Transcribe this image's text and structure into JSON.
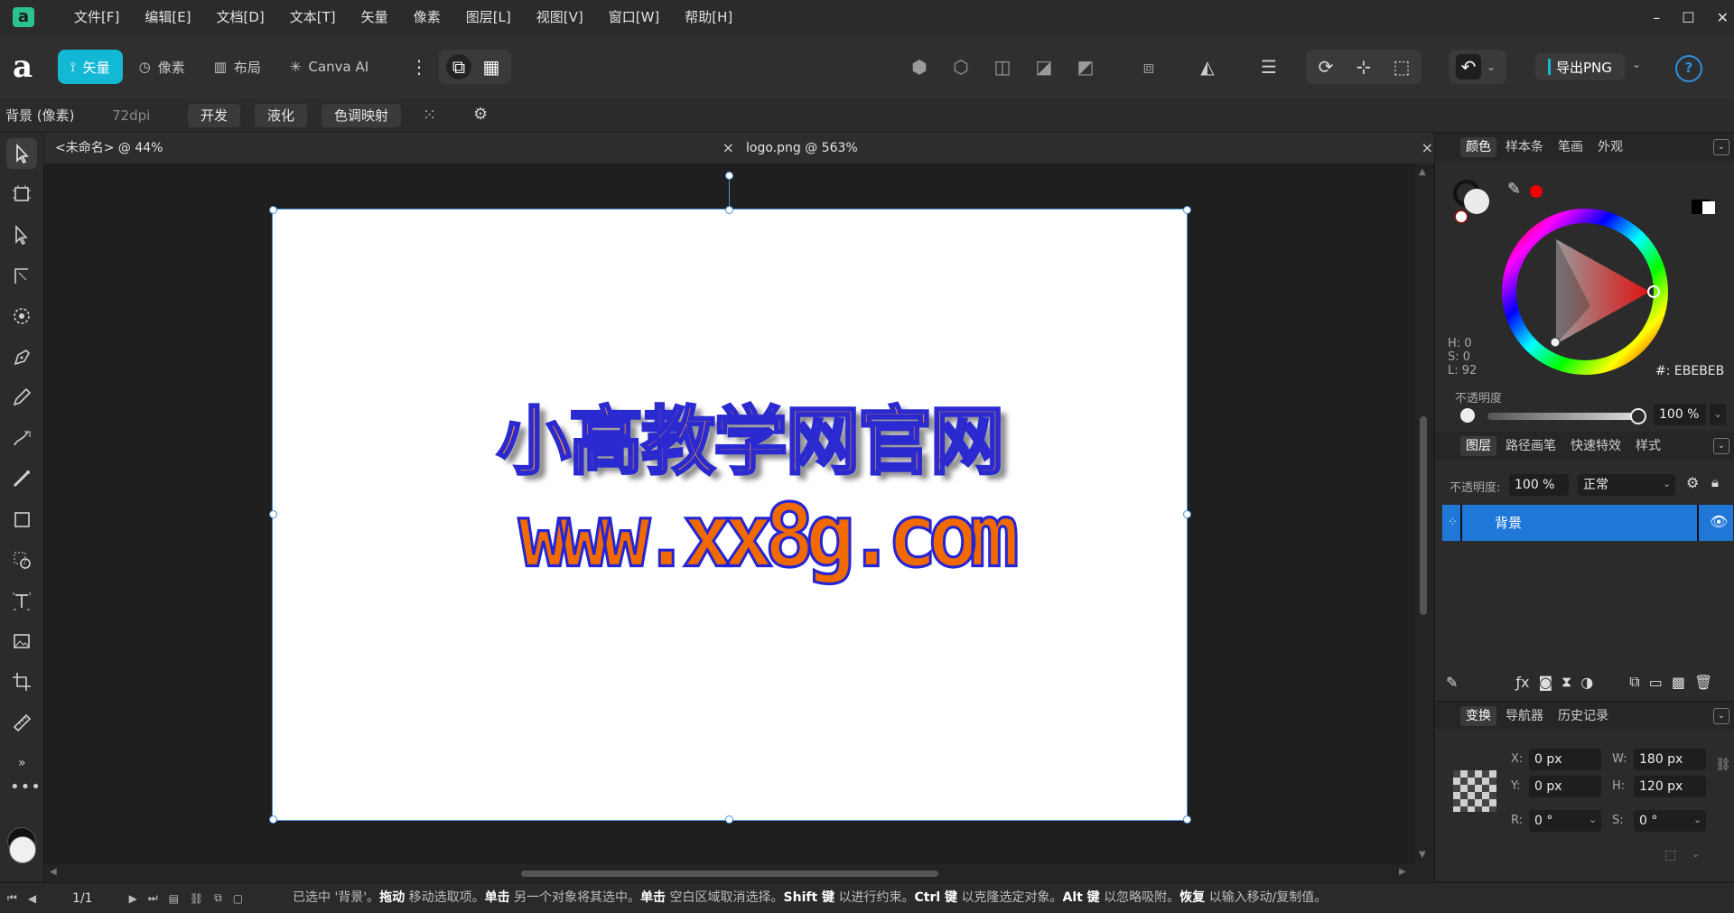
{
  "menubar": {
    "items": [
      "文件[F]",
      "编辑[E]",
      "文档[D]",
      "文本[T]",
      "矢量",
      "像素",
      "图层[L]",
      "视图[V]",
      "窗口[W]",
      "帮助[H]"
    ],
    "window_controls": [
      "–",
      "☐",
      "✕"
    ]
  },
  "toolbar": {
    "personas": [
      {
        "label": "矢量",
        "active": true
      },
      {
        "label": "像素",
        "active": false
      },
      {
        "label": "布局",
        "active": false
      },
      {
        "label": "Canva AI",
        "active": false
      }
    ],
    "export_label": "导出PNG",
    "help_label": "?"
  },
  "context": {
    "layer_label": "背景 (像素)",
    "dpi": "72dpi",
    "buttons": [
      "开发",
      "液化",
      "色调映射"
    ]
  },
  "documents": {
    "tabs": [
      {
        "title": "<未命名> @ 44%"
      },
      {
        "title": "logo.png @ 563%"
      }
    ],
    "close_glyph": "×",
    "canvas_text": {
      "line1": "小高教学网官网",
      "line2": "www.xx8g.com"
    }
  },
  "color_panel": {
    "tabs": [
      "颜色",
      "样本条",
      "笔画",
      "外观"
    ],
    "h": "H: 0",
    "s": "S: 0",
    "l": "L: 92",
    "hex": "#: EBEBEB",
    "opacity_label": "不透明度",
    "opacity_value": "100 %"
  },
  "layers_panel": {
    "tabs": [
      "图层",
      "路径画笔",
      "快速特效",
      "样式"
    ],
    "opacity_label": "不透明度:",
    "opacity_value": "100 %",
    "blend_mode": "正常",
    "layers": [
      {
        "name": "背景"
      }
    ]
  },
  "transform_panel": {
    "tabs": [
      "变换",
      "导航器",
      "历史记录"
    ],
    "x": "0 px",
    "y": "0 px",
    "w": "180 px",
    "h": "120 px",
    "r": "0 °",
    "s": "0 °",
    "labels": {
      "x": "X:",
      "y": "Y:",
      "w": "W:",
      "h": "H:",
      "r": "R:",
      "s": "S:"
    }
  },
  "status": {
    "page": "1/1",
    "parts": [
      {
        "t": "已选中 '背景'。",
        "b": false
      },
      {
        "t": "拖动",
        "b": true
      },
      {
        "t": " 移动选取项。",
        "b": false
      },
      {
        "t": "单击",
        "b": true
      },
      {
        "t": " 另一个对象将其选中。",
        "b": false
      },
      {
        "t": "单击",
        "b": true
      },
      {
        "t": " 空白区域取消选择。",
        "b": false
      },
      {
        "t": "Shift 键",
        "b": true
      },
      {
        "t": " 以进行约束。",
        "b": false
      },
      {
        "t": "Ctrl 键",
        "b": true
      },
      {
        "t": " 以克隆选定对象。",
        "b": false
      },
      {
        "t": "Alt 键",
        "b": true
      },
      {
        "t": " 以忽略吸附。",
        "b": false
      },
      {
        "t": "恢复",
        "b": true
      },
      {
        "t": " 以输入移动/复制值。",
        "b": false
      }
    ]
  },
  "colors": {
    "accent": "#12b8d4",
    "selection": "#2f7fe0",
    "logo_orange": "#f06a00",
    "logo_outline": "#2424d8"
  }
}
